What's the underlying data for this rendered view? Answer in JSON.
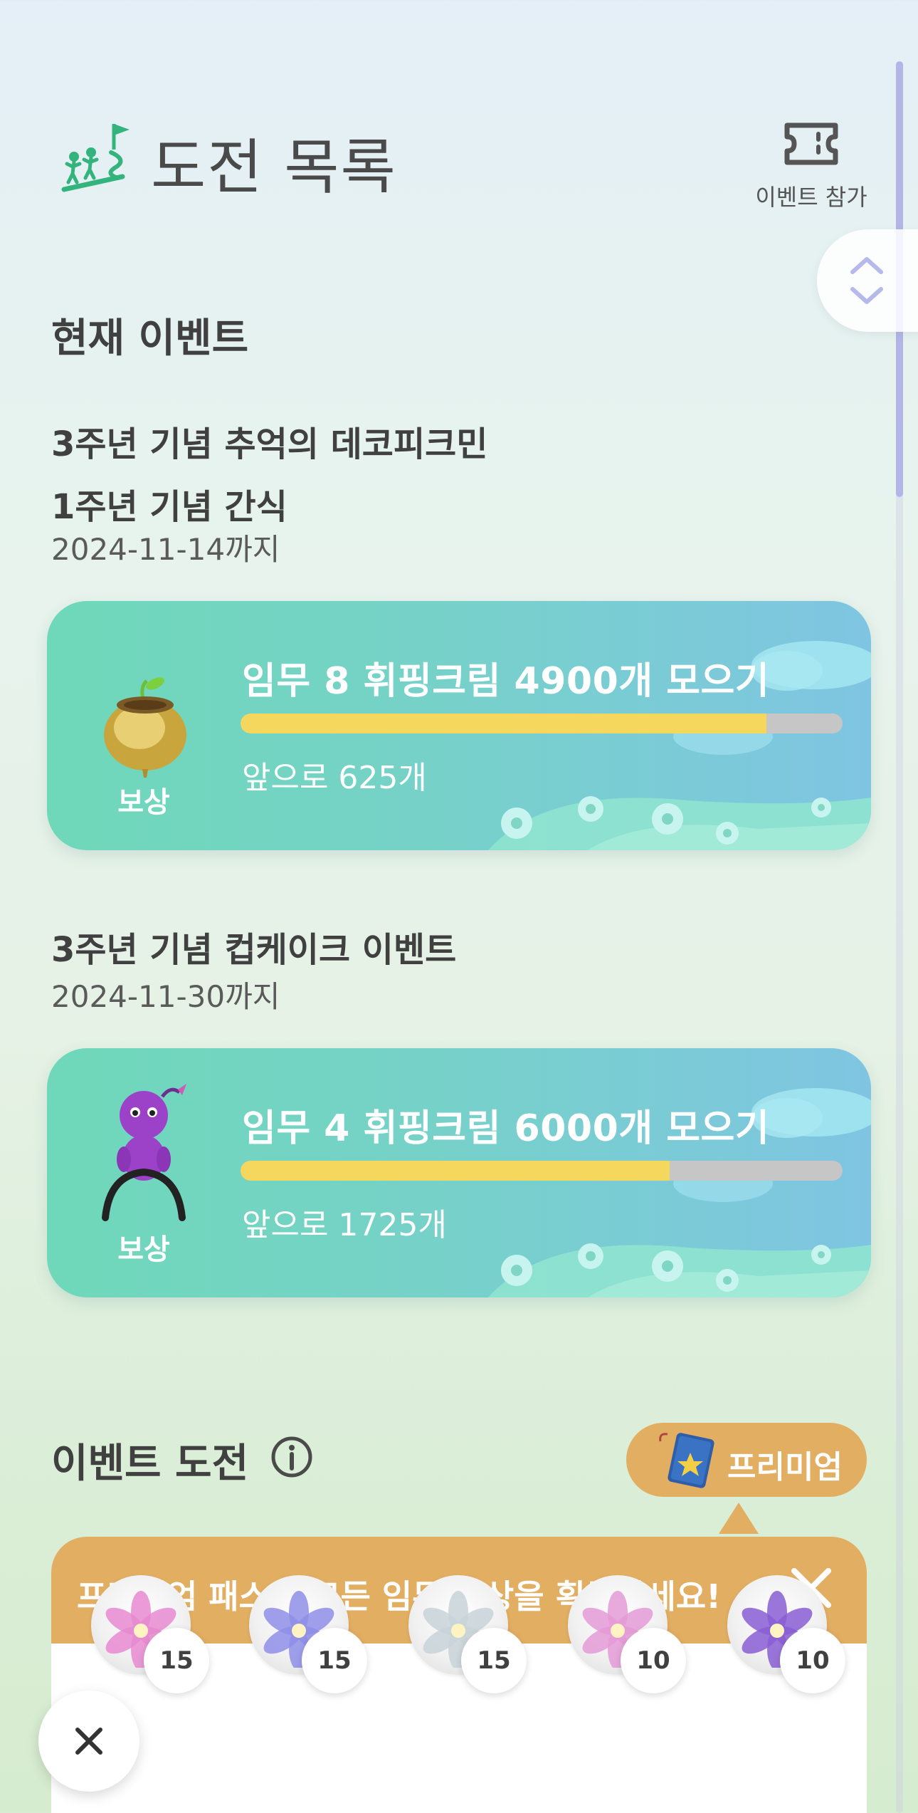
{
  "header": {
    "title": "도전 목록",
    "entry_label": "이벤트 참가"
  },
  "current_events": {
    "section_title": "현재 이벤트",
    "events": [
      {
        "name_lines": [
          "3주년 기념 추억의 데코피크민",
          "1주년 기념 간식"
        ],
        "deadline": "2024-11-14까지",
        "task": "임무 8 휘핑크림 4900개 모으기",
        "progress": 0.873,
        "remaining": "앞으로 625개",
        "reward_label": "보상",
        "reward_icon": "golden-seed-pot-icon"
      },
      {
        "name_lines": [
          "3주년 기념 컵케이크 이벤트"
        ],
        "deadline": "2024-11-30까지",
        "task": "임무 4 휘핑크림 6000개 모으기",
        "progress": 0.7125,
        "remaining": "앞으로 1725개",
        "reward_label": "보상",
        "reward_icon": "purple-pikmin-icon"
      }
    ]
  },
  "event_challenge": {
    "section_title": "이벤트 도전",
    "premium_label": "프리미엄",
    "popup_message": "프리미엄 패스로 모든 임무 보상을 획득하세요!",
    "rewards": [
      {
        "icon": "pink-flower-icon",
        "count": "15",
        "color": "#e88ad0"
      },
      {
        "icon": "blue-flower-icon",
        "count": "15",
        "color": "#8e8ee8"
      },
      {
        "icon": "white-flower-icon",
        "count": "15",
        "color": "#c8d4d8"
      },
      {
        "icon": "pink-puff-flower-icon",
        "count": "10",
        "color": "#e49ad6"
      },
      {
        "icon": "purple-puff-flower-icon",
        "count": "10",
        "color": "#8a5ed4"
      }
    ]
  },
  "colors": {
    "card_gradient_start": "#6fd8b9",
    "card_gradient_end": "#7fc5e2",
    "progress_fill": "#f6d75d",
    "progress_track": "#c6c6c6",
    "premium": "#e2ae62",
    "logo_green": "#34b47d"
  }
}
